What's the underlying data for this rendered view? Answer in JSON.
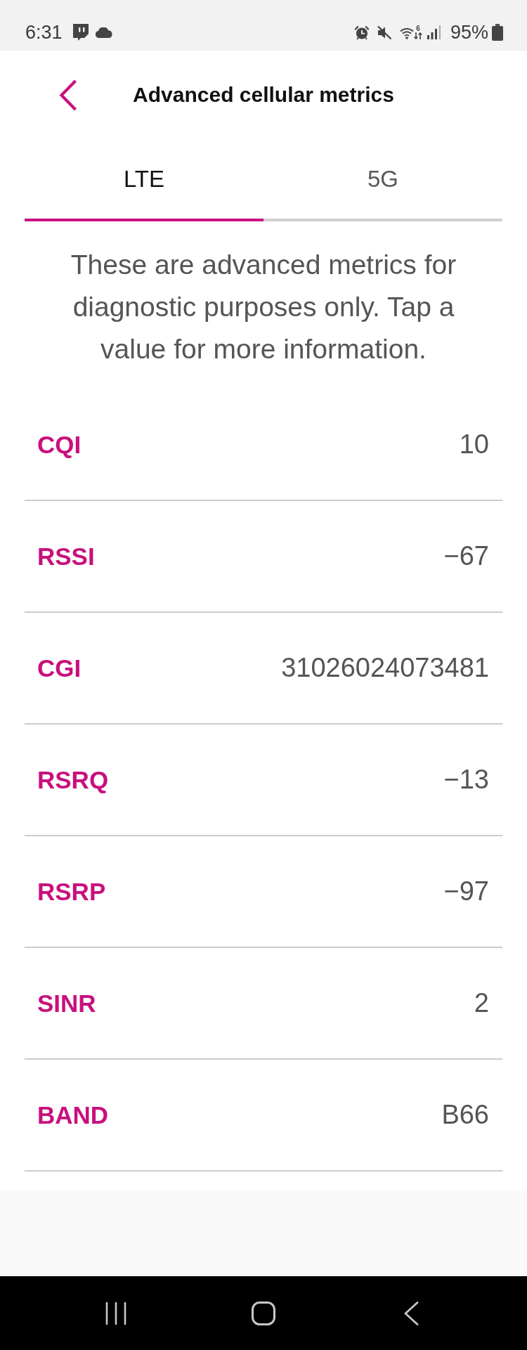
{
  "status_bar": {
    "time": "6:31",
    "wifi_label": "6",
    "battery": "95%"
  },
  "header": {
    "title": "Advanced cellular metrics"
  },
  "tabs": [
    {
      "label": "LTE",
      "selected": true
    },
    {
      "label": "5G",
      "selected": false
    }
  ],
  "description": "These are advanced metrics for diagnostic purposes only. Tap a value for more information.",
  "metrics": [
    {
      "name": "CQI",
      "value": "10"
    },
    {
      "name": "RSSI",
      "value": "−67"
    },
    {
      "name": "CGI",
      "value": "31026024073481"
    },
    {
      "name": "RSRQ",
      "value": "−13"
    },
    {
      "name": "RSRP",
      "value": "−97"
    },
    {
      "name": "SINR",
      "value": "2"
    },
    {
      "name": "BAND",
      "value": "B66"
    }
  ]
}
